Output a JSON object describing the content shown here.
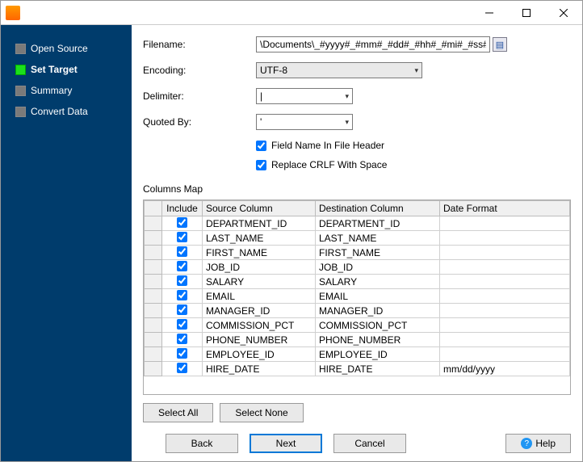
{
  "titlebar": {
    "title": ""
  },
  "sidebar": {
    "items": [
      {
        "label": "Open Source",
        "active": false,
        "bold": false
      },
      {
        "label": "Set Target",
        "active": true,
        "bold": true
      },
      {
        "label": "Summary",
        "active": false,
        "bold": false
      },
      {
        "label": "Convert Data",
        "active": false,
        "bold": false
      }
    ]
  },
  "form": {
    "filename_label": "Filename:",
    "filename_value": "\\Documents\\_#yyyy#_#mm#_#dd#_#hh#_#mi#_#ss#.txt",
    "encoding_label": "Encoding:",
    "encoding_value": "UTF-8",
    "delimiter_label": "Delimiter:",
    "delimiter_value": "|",
    "quotedby_label": "Quoted By:",
    "quotedby_value": "'",
    "chk_header_label": "Field Name In File Header",
    "chk_header_checked": true,
    "chk_crlf_label": "Replace CRLF With Space",
    "chk_crlf_checked": true
  },
  "columns": {
    "title": "Columns Map",
    "headers": {
      "include": "Include",
      "source": "Source Column",
      "dest": "Destination Column",
      "datefmt": "Date Format"
    },
    "rows": [
      {
        "include": true,
        "source": "DEPARTMENT_ID",
        "dest": "DEPARTMENT_ID",
        "datefmt": ""
      },
      {
        "include": true,
        "source": "LAST_NAME",
        "dest": "LAST_NAME",
        "datefmt": ""
      },
      {
        "include": true,
        "source": "FIRST_NAME",
        "dest": "FIRST_NAME",
        "datefmt": ""
      },
      {
        "include": true,
        "source": "JOB_ID",
        "dest": "JOB_ID",
        "datefmt": ""
      },
      {
        "include": true,
        "source": "SALARY",
        "dest": "SALARY",
        "datefmt": ""
      },
      {
        "include": true,
        "source": "EMAIL",
        "dest": "EMAIL",
        "datefmt": ""
      },
      {
        "include": true,
        "source": "MANAGER_ID",
        "dest": "MANAGER_ID",
        "datefmt": ""
      },
      {
        "include": true,
        "source": "COMMISSION_PCT",
        "dest": "COMMISSION_PCT",
        "datefmt": ""
      },
      {
        "include": true,
        "source": "PHONE_NUMBER",
        "dest": "PHONE_NUMBER",
        "datefmt": ""
      },
      {
        "include": true,
        "source": "EMPLOYEE_ID",
        "dest": "EMPLOYEE_ID",
        "datefmt": ""
      },
      {
        "include": true,
        "source": "HIRE_DATE",
        "dest": "HIRE_DATE",
        "datefmt": "mm/dd/yyyy"
      }
    ]
  },
  "buttons": {
    "select_all": "Select All",
    "select_none": "Select None",
    "back": "Back",
    "next": "Next",
    "cancel": "Cancel",
    "help": "Help"
  }
}
